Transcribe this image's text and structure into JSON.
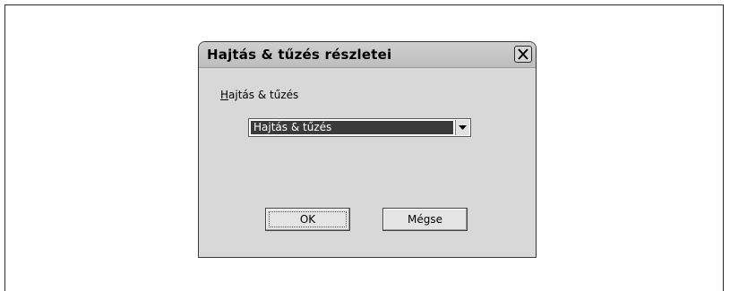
{
  "dialog": {
    "title": "Hajtás & tűzés részletei",
    "field_label_accel": "H",
    "field_label_rest": "ajtás & tűzés",
    "select": {
      "selected_value": "Hajtás & tűzés"
    },
    "buttons": {
      "ok_label": "OK",
      "cancel_label": "Mégse"
    }
  },
  "icons": {
    "close": "close-icon",
    "dropdown": "chevron-down-icon"
  }
}
